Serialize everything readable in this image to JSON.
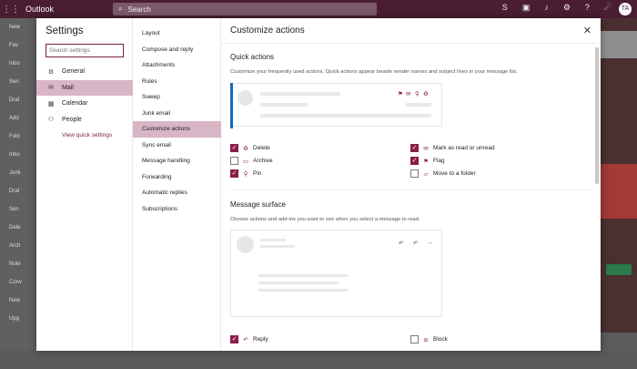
{
  "app": {
    "name": "Outlook",
    "search_placeholder": "Search",
    "avatar": "TA"
  },
  "bg_left": [
    "New",
    "Fav",
    "Inbo",
    "Sen",
    "Draf",
    "Add",
    "Fold",
    "Inbo",
    "Junk",
    "Draf",
    "Sen",
    "Dele",
    "Arch",
    "Note",
    "Conv",
    "New",
    "Upg"
  ],
  "settings": {
    "title": "Settings",
    "search_placeholder": "Search settings",
    "nav": [
      {
        "label": "General",
        "icon": "gear-icon",
        "selected": false
      },
      {
        "label": "Mail",
        "icon": "mail-icon",
        "selected": true
      },
      {
        "label": "Calendar",
        "icon": "calendar-icon",
        "selected": false
      },
      {
        "label": "People",
        "icon": "people-icon",
        "selected": false
      }
    ],
    "view_quick": "View quick settings"
  },
  "mail_nav": [
    "Layout",
    "Compose and reply",
    "Attachments",
    "Rules",
    "Sweep",
    "Junk email",
    "Customize actions",
    "Sync email",
    "Message handling",
    "Forwarding",
    "Automatic replies",
    "Subscriptions"
  ],
  "mail_nav_selected": 6,
  "pane": {
    "title": "Customize actions",
    "quick": {
      "heading": "Quick actions",
      "desc": "Customize your frequently used actions. Quick actions appear beside sender names and subject lines in your message list.",
      "options": [
        {
          "label": "Delete",
          "checked": true,
          "icon": "trash-icon"
        },
        {
          "label": "Archive",
          "checked": false,
          "icon": "archive-icon"
        },
        {
          "label": "Pin",
          "checked": true,
          "icon": "pin-icon"
        },
        {
          "label": "Mark as read or unread",
          "checked": true,
          "icon": "envelope-icon"
        },
        {
          "label": "Flag",
          "checked": true,
          "icon": "flag-icon"
        },
        {
          "label": "Move to a folder",
          "checked": false,
          "icon": "folder-icon"
        }
      ]
    },
    "surface": {
      "heading": "Message surface",
      "desc": "Choose actions and add-ins you want to see when you select a message to read.",
      "options": [
        {
          "label": "Reply",
          "checked": true,
          "icon": "reply-icon"
        },
        {
          "label": "Block",
          "checked": false,
          "icon": "block-icon"
        }
      ]
    }
  },
  "colors": {
    "accent": "#8b1e48",
    "selected": "#d9b6c5",
    "topbar": "#4a1d33"
  }
}
